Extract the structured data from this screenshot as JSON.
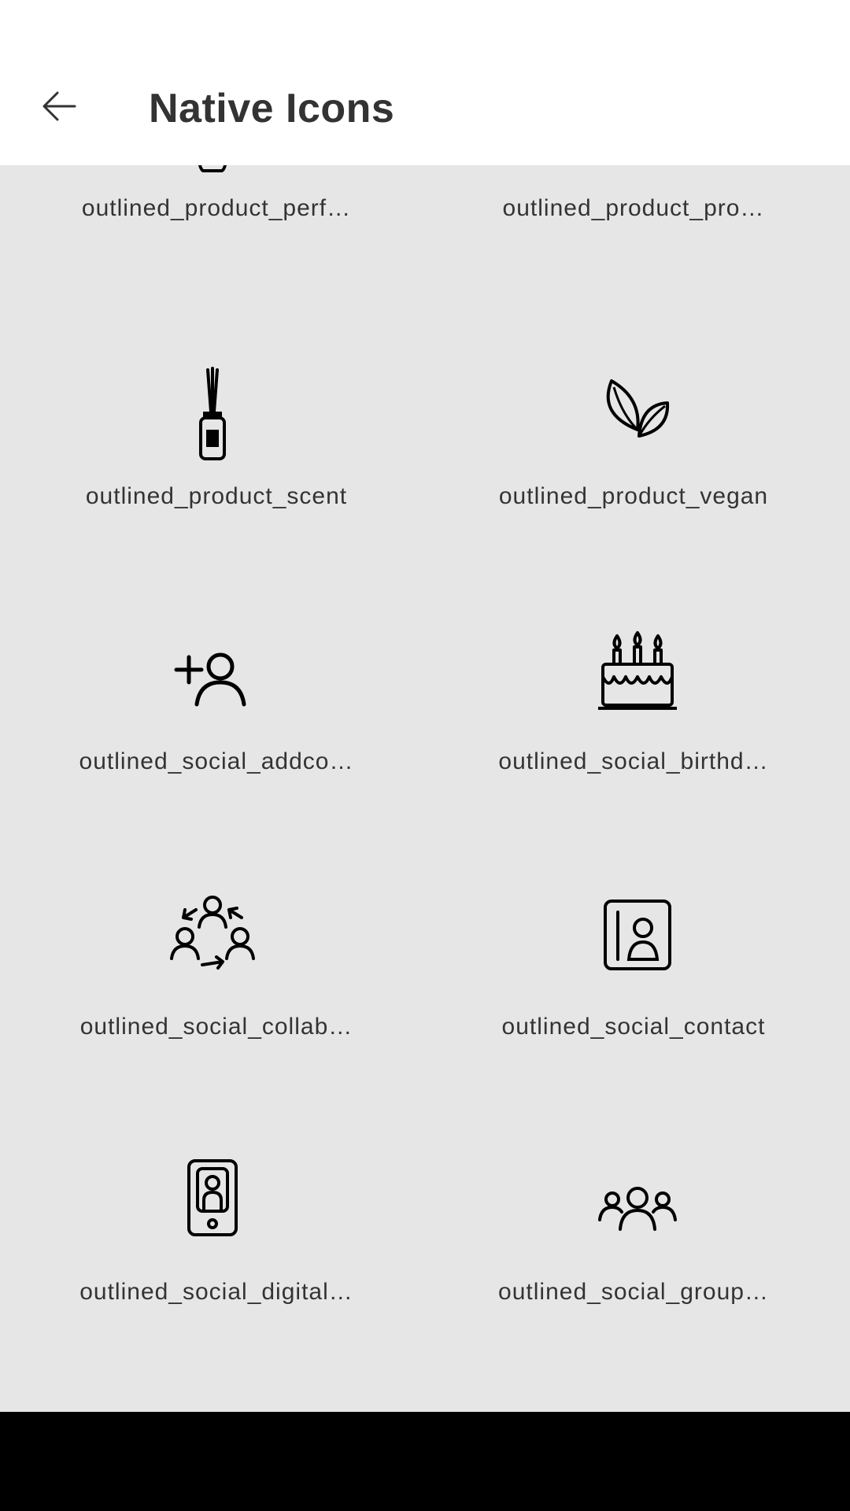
{
  "header": {
    "title": "Native Icons",
    "back_icon": "arrow-left-icon"
  },
  "icons": [
    {
      "label": "outlined_product_perf…",
      "icon": "perfume-icon"
    },
    {
      "label": "outlined_product_pro…",
      "icon": "product-icon"
    },
    {
      "label": "outlined_product_scent",
      "icon": "scent-diffuser-icon"
    },
    {
      "label": "outlined_product_vegan",
      "icon": "leaves-icon"
    },
    {
      "label": "outlined_social_addco…",
      "icon": "add-contact-icon"
    },
    {
      "label": "outlined_social_birthd…",
      "icon": "birthday-cake-icon"
    },
    {
      "label": "outlined_social_collab…",
      "icon": "collaboration-icon"
    },
    {
      "label": "outlined_social_contact",
      "icon": "contact-card-icon"
    },
    {
      "label": "outlined_social_digital…",
      "icon": "digital-card-phone-icon"
    },
    {
      "label": "outlined_social_group…",
      "icon": "group-icon"
    }
  ],
  "colors": {
    "background": "#e6e6e6",
    "appbar": "#ffffff",
    "text": "#333333",
    "navbar": "#000000"
  }
}
